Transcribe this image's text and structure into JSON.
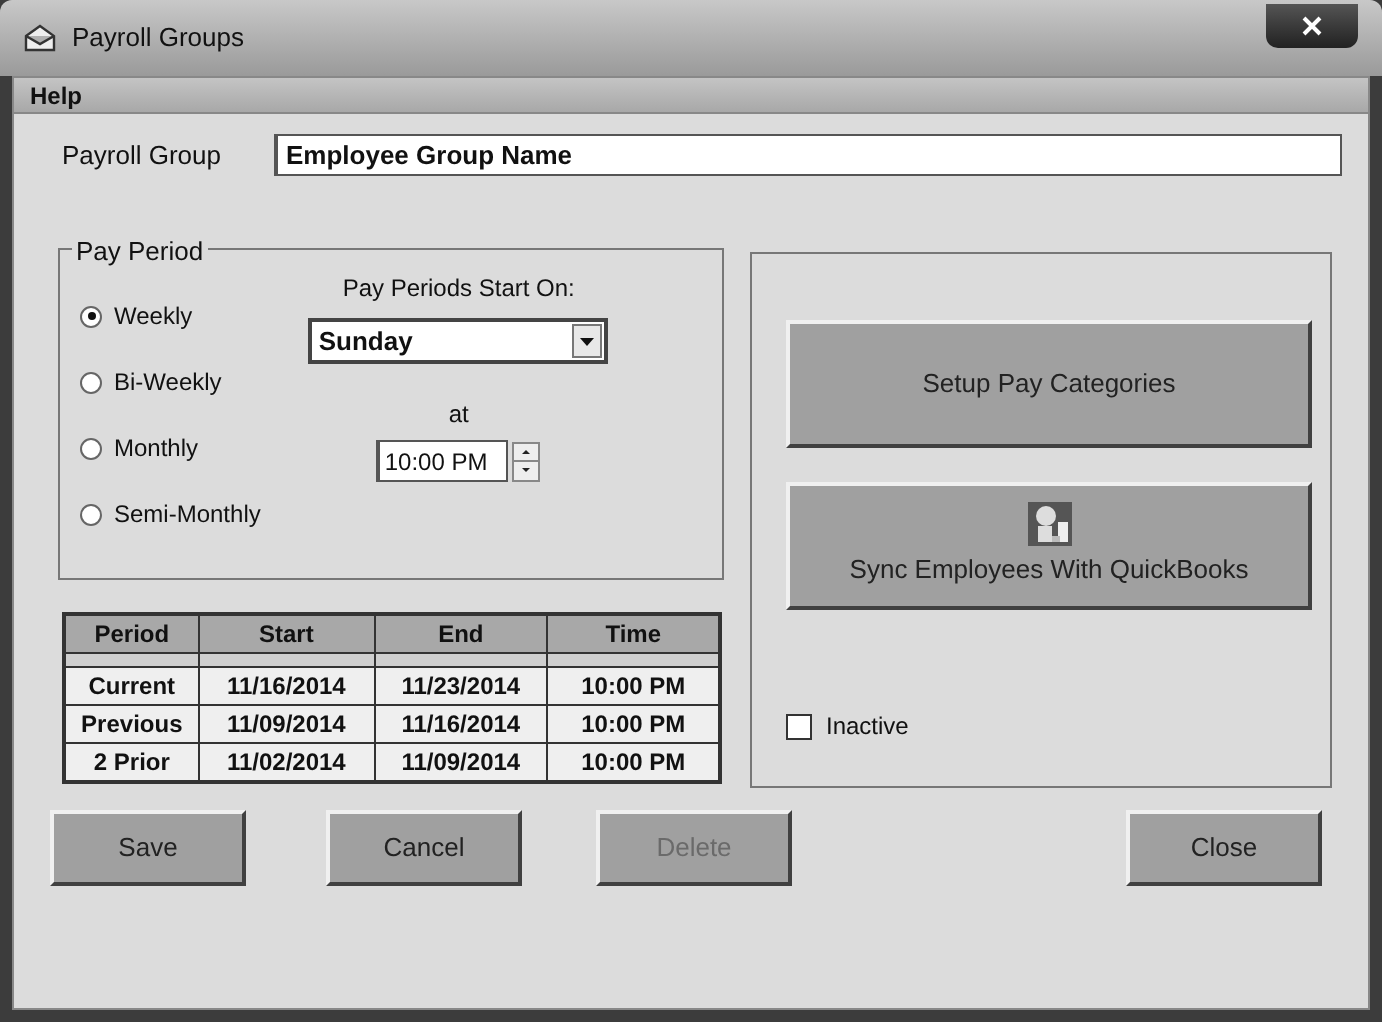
{
  "window": {
    "title": "Payroll Groups"
  },
  "menu": [
    "Help"
  ],
  "payroll_group": {
    "label": "Payroll Group",
    "value": "Employee Group Name"
  },
  "pay_period": {
    "title": "Pay Period",
    "options": [
      {
        "label": "Weekly",
        "selected": true
      },
      {
        "label": "Bi-Weekly",
        "selected": false
      },
      {
        "label": "Monthly",
        "selected": false
      },
      {
        "label": "Semi-Monthly",
        "selected": false
      }
    ],
    "start_label": "Pay Periods Start On:",
    "start_day": "Sunday",
    "at_label": "at",
    "time": "10:00 PM"
  },
  "table": {
    "columns": [
      "Period",
      "Start",
      "End",
      "Time"
    ],
    "rows": [
      [
        "Current",
        "11/16/2014",
        "11/23/2014",
        "10:00 PM"
      ],
      [
        "Previous",
        "11/09/2014",
        "11/16/2014",
        "10:00 PM"
      ],
      [
        "2 Prior",
        "11/02/2014",
        "11/09/2014",
        "10:00 PM"
      ]
    ]
  },
  "side_buttons": [
    {
      "label": "Setup Pay Categories",
      "kind": "text"
    },
    {
      "label": "Sync Employees With QuickBooks",
      "kind": "icon"
    }
  ],
  "inactive": {
    "label": "Inactive",
    "checked": false
  },
  "buttons": [
    {
      "label": "Save",
      "disabled": false
    },
    {
      "label": "Cancel",
      "disabled": false
    },
    {
      "label": "Delete",
      "disabled": true
    },
    {
      "label": "Close",
      "disabled": false
    }
  ]
}
